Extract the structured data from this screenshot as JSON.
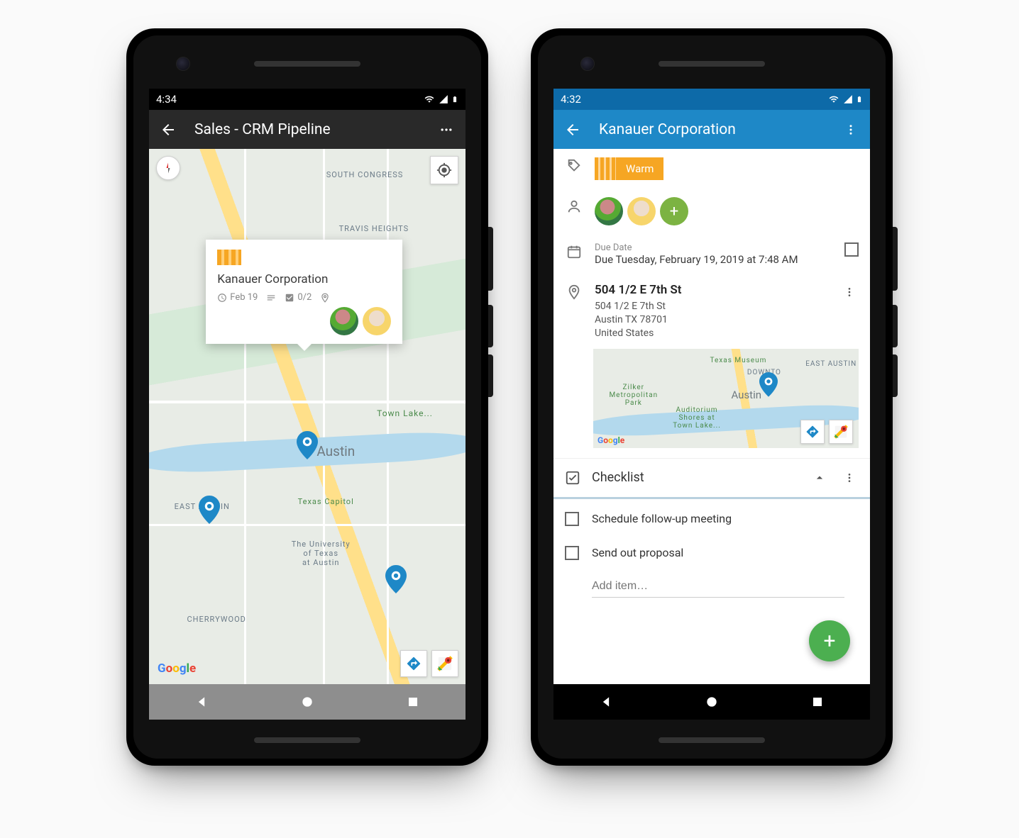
{
  "left": {
    "status_time": "4:34",
    "appbar_title": "Sales - CRM Pipeline",
    "labels": {
      "south_congress": "SOUTH\nCONGRESS",
      "travis_heights": "TRAVIS HEIGHTS",
      "austin": "Austin",
      "texas_capitol": "Texas Capitol",
      "east_austin": "EAST AUSTIN",
      "cherrywood": "CHERRYWOOD",
      "ut": "The University\nof Texas\nat Austin",
      "town_lake": "Town Lake..."
    },
    "card": {
      "title": "Kanauer Corporation",
      "date": "Feb 19",
      "tasks": "0/2"
    }
  },
  "right": {
    "status_time": "4:32",
    "appbar_title": "Kanauer Corporation",
    "warm": "Warm",
    "due_label": "Due Date",
    "due_value": "Due Tuesday, February 19, 2019 at 7:48 AM",
    "address": {
      "title": "504 1/2 E 7th St",
      "line1": "504 1/2 E 7th St",
      "line2": "Austin TX 78701",
      "line3": "United States"
    },
    "mini_labels": {
      "texas_museum": "Texas Museum",
      "downtown": "DOWNTO",
      "austin": "Austin",
      "east_austin": "EAST AUSTIN",
      "zilker": "Zilker\nMetropolitan\nPark",
      "auditorium": "Auditorium\nShores at\nTown Lake..."
    },
    "checklist_title": "Checklist",
    "checklist": [
      "Schedule follow-up meeting",
      "Send out proposal"
    ],
    "add_placeholder": "Add item…"
  }
}
